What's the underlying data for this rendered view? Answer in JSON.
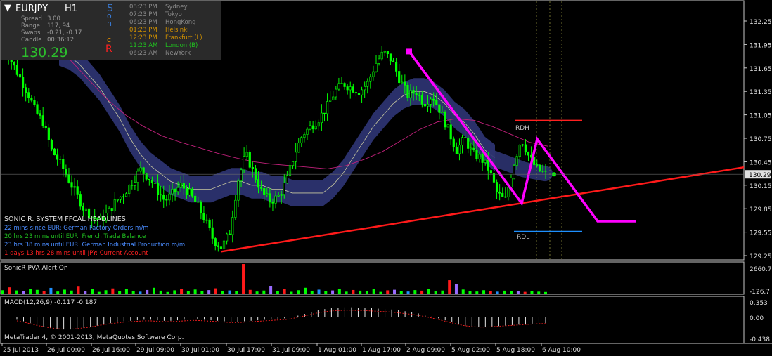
{
  "symbol_header": {
    "symbol": "EURJPY",
    "timeframe": "H1",
    "menu_glyph": "▼"
  },
  "info_panel": {
    "rows": [
      {
        "label": "Spread",
        "value": "3.00"
      },
      {
        "label": "Range",
        "value": "117, 94"
      },
      {
        "label": "Swaps",
        "value": "-0.21, -0.17"
      },
      {
        "label": "Candle",
        "value": "00:36:12"
      }
    ],
    "big_price": "130.29",
    "sonicr_letters": [
      "S",
      "o",
      "n",
      "i",
      "c",
      "R"
    ],
    "sonicr_colors": [
      "#3a7bd5",
      "#3a7bd5",
      "#3a7bd5",
      "#3a7bd5",
      "#e08a00",
      "#ff2020"
    ]
  },
  "sessions": [
    {
      "time": "08:23 PM",
      "city": "Sydney",
      "color": "#8a8a8a"
    },
    {
      "time": "07:23 PM",
      "city": "Tokyo",
      "color": "#8a8a8a"
    },
    {
      "time": "06:23 PM",
      "city": "HongKong",
      "color": "#8a8a8a"
    },
    {
      "time": "01:23 PM",
      "city": "Helsinki",
      "color": "#d09000"
    },
    {
      "time": "12:23 PM",
      "city": "Frankfurt  (L)",
      "color": "#d09000"
    },
    {
      "time": "11:23 AM",
      "city": "London  (B)",
      "color": "#20c020"
    },
    {
      "time": "06:23 AM",
      "city": "NewYork",
      "color": "#8a8a8a"
    }
  ],
  "headlines": {
    "title": "SONIC R. SYSTEM  FFCAL HEADLINES:",
    "items": [
      {
        "text": "22 mins since EUR: German Factory Orders m/m",
        "color": "#4a8cff"
      },
      {
        "text": "20 hrs 23 mins until EUR: French Trade Balance",
        "color": "#20c020"
      },
      {
        "text": "23 hrs 38 mins until EUR: German Industrial Production m/m",
        "color": "#4a8cff"
      },
      {
        "text": "1 days 13 hrs 28 mins until JPY: Current Account",
        "color": "#ff2020"
      }
    ]
  },
  "labels": {
    "rdh": "RDH",
    "rdl": "RDL"
  },
  "copyright": "MetaTrader 4, © 2001-2013, MetaQuotes Software Corp.",
  "colors": {
    "candle": "#00ff00",
    "band": "#2c3370",
    "ema": "#c8c8a0",
    "ma_slow": "#c0207a",
    "trend": "#ff1a1a",
    "magenta": "#ff00ff",
    "rdh": "#ff2020",
    "rdl": "#1e90ff",
    "grid_frame": "#c8c8c8"
  },
  "chart_data": [
    {
      "type": "line",
      "title": "EURJPY H1",
      "yaxis_ticks": [
        "132.25",
        "131.95",
        "131.65",
        "131.35",
        "131.05",
        "130.75",
        "130.45",
        "130.15",
        "129.85",
        "129.55",
        "129.25"
      ],
      "current_price": "130.29",
      "ylim": [
        129.18,
        132.35
      ],
      "x_ticks": [
        "25 Jul 2013",
        "26 Jul 00:00",
        "26 Jul 16:00",
        "29 Jul 09:00",
        "30 Jul 01:00",
        "30 Jul 17:00",
        "31 Jul 09:00",
        "1 Aug 01:00",
        "1 Aug 17:00",
        "2 Aug 09:00",
        "5 Aug 02:00",
        "5 Aug 18:00",
        "6 Aug 10:00"
      ],
      "close_path": [
        131.98,
        131.75,
        131.55,
        131.35,
        131.1,
        130.95,
        130.6,
        130.45,
        130.25,
        130.05,
        129.85,
        129.75,
        129.7,
        129.8,
        129.95,
        130.05,
        130.2,
        130.35,
        130.25,
        130.1,
        129.95,
        130.05,
        130.15,
        130.05,
        129.9,
        129.7,
        129.45,
        129.35,
        129.55,
        130.2,
        130.55,
        130.3,
        130.05,
        129.95,
        130.0,
        130.2,
        130.55,
        130.8,
        130.9,
        131.0,
        131.15,
        131.35,
        131.45,
        131.4,
        131.35,
        131.45,
        131.7,
        131.85,
        131.75,
        131.5,
        131.3,
        131.35,
        131.2,
        131.3,
        131.1,
        130.85,
        130.6,
        130.75,
        130.55,
        130.5,
        130.35,
        130.05,
        129.95,
        130.4,
        130.75,
        130.5,
        130.35,
        130.3
      ],
      "band_center": [
        131.85,
        131.8,
        131.7,
        131.55,
        131.4,
        131.2,
        131.0,
        130.75,
        130.55,
        130.4,
        130.3,
        130.2,
        130.15,
        130.1,
        130.1,
        130.1,
        130.15,
        130.2,
        130.2,
        130.15,
        130.15,
        130.1,
        130.1,
        130.05,
        130.05,
        130.05,
        130.05,
        130.15,
        130.3,
        130.5,
        130.7,
        130.9,
        131.05,
        131.2,
        131.3,
        131.35,
        131.35,
        131.3,
        131.2,
        131.05,
        130.95,
        130.8,
        130.6,
        130.5
      ],
      "ma_slow": [
        131.9,
        131.75,
        131.5,
        131.25,
        131.05,
        130.9,
        130.78,
        130.7,
        130.63,
        130.56,
        130.5,
        130.45,
        130.42,
        130.4,
        130.38,
        130.36,
        130.4,
        130.48,
        130.58,
        130.72,
        130.86,
        130.96,
        131.0,
        130.98,
        130.9,
        130.8,
        130.7,
        130.65
      ],
      "annotations": [
        {
          "type": "hline",
          "label": "RDH",
          "y": 130.98
        },
        {
          "type": "hline",
          "label": "RDL",
          "y": 129.56
        },
        {
          "type": "trendline",
          "from": [
            "31 Jul 03:00",
            129.3
          ],
          "to": [
            "6 Aug 20:00",
            130.38
          ]
        },
        {
          "type": "projection",
          "points": [
            [
              "2 Aug 03:00",
              131.86
            ],
            [
              "5 Aug 20:00",
              129.92
            ],
            [
              "6 Aug 04:00",
              130.74
            ],
            [
              "6 Aug 16:00",
              129.69
            ],
            [
              "7 Aug 00:00",
              129.69
            ]
          ]
        }
      ]
    },
    {
      "type": "bar",
      "title": "SonicR PVA   Alert On",
      "yaxis_ticks": [
        "2660.7",
        "-126.7"
      ],
      "ylim": [
        -126.7,
        2660.7
      ],
      "bar_colors": [
        "#ff1a1a",
        "#00ff00",
        "#9a6bff",
        "#1e90ff"
      ],
      "values": [
        300,
        560,
        280,
        190,
        420,
        330,
        240,
        510,
        180,
        350,
        270,
        620,
        210,
        390,
        150,
        300,
        460,
        220,
        380,
        250,
        170,
        320,
        520,
        260,
        140,
        290,
        410,
        230,
        360,
        200,
        310,
        470,
        190,
        280,
        240,
        2660,
        330,
        180,
        270,
        640,
        210,
        390,
        160,
        300,
        520,
        240,
        350,
        190,
        280,
        430,
        170,
        320,
        260,
        200,
        380,
        150,
        290,
        340,
        230,
        180,
        310,
        260,
        420,
        190,
        270,
        1200,
        880,
        360,
        240,
        180,
        300,
        210,
        170,
        260,
        190,
        230,
        150,
        200,
        170,
        140
      ]
    },
    {
      "type": "bar",
      "title": "MACD(12,26,9) -0.117 -0.187",
      "yaxis_ticks": [
        "0.353",
        "0.00",
        "-0.438"
      ],
      "ylim": [
        -0.438,
        0.353
      ],
      "values": [
        -0.05,
        -0.08,
        -0.12,
        -0.16,
        -0.19,
        -0.22,
        -0.24,
        -0.25,
        -0.25,
        -0.24,
        -0.22,
        -0.2,
        -0.17,
        -0.14,
        -0.12,
        -0.1,
        -0.08,
        -0.07,
        -0.06,
        -0.05,
        -0.05,
        -0.06,
        -0.07,
        -0.07,
        -0.06,
        -0.05,
        -0.04,
        -0.04,
        -0.05,
        -0.06,
        -0.07,
        -0.08,
        -0.09,
        -0.09,
        -0.08,
        -0.07,
        -0.06,
        -0.05,
        -0.04,
        -0.03,
        -0.02,
        0.0,
        0.04,
        0.08,
        0.12,
        0.16,
        0.19,
        0.21,
        0.22,
        0.23,
        0.23,
        0.22,
        0.22,
        0.21,
        0.2,
        0.19,
        0.18,
        0.16,
        0.14,
        0.12,
        0.09,
        0.06,
        0.02,
        -0.02,
        -0.06,
        -0.1,
        -0.14,
        -0.17,
        -0.19,
        -0.2,
        -0.2,
        -0.19,
        -0.18,
        -0.17,
        -0.16,
        -0.15,
        -0.14,
        -0.13,
        -0.12,
        -0.117
      ]
    }
  ]
}
